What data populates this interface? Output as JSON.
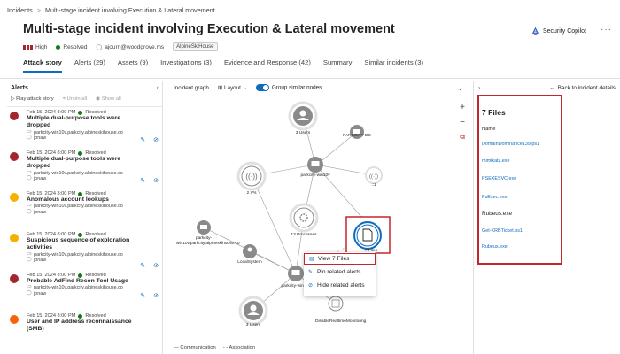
{
  "breadcrumb": [
    "Incidents",
    "Multi-stage incident involving Execution & Lateral movement"
  ],
  "title": "Multi-stage incident involving Execution & Lateral movement",
  "header_actions": {
    "copilot": "Security Copilot",
    "more": "···"
  },
  "meta": {
    "severity": "High",
    "status": "Resolved",
    "assignee": "ajourn@woodgrove.ms",
    "tag": "AlpineSkiHouse"
  },
  "tabs": [
    {
      "label": "Attack story",
      "active": true
    },
    {
      "label": "Alerts (29)"
    },
    {
      "label": "Assets (9)"
    },
    {
      "label": "Investigations (3)"
    },
    {
      "label": "Evidence and Response (42)"
    },
    {
      "label": "Summary"
    },
    {
      "label": "Similar incidents (3)"
    }
  ],
  "alerts_panel": {
    "heading": "Alerts",
    "play": "Play attack story",
    "unpin": "Unpin all",
    "show": "Show all",
    "items": [
      {
        "color": "#a4262c",
        "date": "Feb 15, 2024 8:00 PM",
        "status": "Resolved",
        "title": "Multiple dual-purpose tools were dropped",
        "device": "parkcity-win10v.parkcity.alpineskihouse.co",
        "user": "jonaw"
      },
      {
        "color": "#a4262c",
        "date": "Feb 15, 2024 8:00 PM",
        "status": "Resolved",
        "title": "Multiple dual-purpose tools were dropped",
        "device": "parkcity-win10v.parkcity.alpineskihouse.co",
        "user": "jonaw"
      },
      {
        "color": "#f8b000",
        "date": "Feb 15, 2024 8:00 PM",
        "status": "Resolved",
        "title": "Anomalous account lookups",
        "device": "parkcity-win10v.parkcity.alpineskihouse.co",
        "user": "jonaw"
      },
      {
        "color": "#f8b000",
        "date": "Feb 15, 2024 8:00 PM",
        "status": "Resolved",
        "title": "Suspicious sequence of exploration activities",
        "device": "parkcity-win10v.parkcity.alpineskihouse.co",
        "user": "jonaw"
      },
      {
        "color": "#a4262c",
        "date": "Feb 15, 2024 8:00 PM",
        "status": "Resolved",
        "title": "Probable AdFind Recon Tool Usage",
        "device": "parkcity-win10v.parkcity.alpineskihouse.co",
        "user": "jonaw"
      },
      {
        "color": "#f7630c",
        "date": "Feb 15, 2024 8:00 PM",
        "status": "Resolved",
        "title": "User and IP address reconnaissance (SMB)",
        "device": "",
        "user": ""
      }
    ]
  },
  "graph": {
    "label": "Incident graph",
    "layout": "Layout",
    "group": "Group similar nodes",
    "nodes": {
      "users_top": "3 Users",
      "dc": "PARKCITY-DC",
      "ips": "2 IPs",
      "win10v": "parkcity-win10v",
      "ip_small": "::1",
      "processes": "13 Processes",
      "files": "7 Files",
      "machine_left": "parkcity-win10v.parkcity.alpineskihouse.co",
      "local_system": "LocalSystem",
      "machine_bottom": "parkcity-win10v",
      "users_bottom": "3 Users",
      "disable_mon": "DisableRealtimeMonitoring"
    },
    "legend": {
      "communication": "Communication",
      "association": "Association"
    }
  },
  "context_menu": [
    {
      "label": "View 7 Files"
    },
    {
      "label": "Pin related alerts"
    },
    {
      "label": "Hide related alerts"
    }
  ],
  "files_pane": {
    "back": "Back to incident details",
    "title": "7 Files",
    "column": "Name",
    "files": [
      {
        "name": "DomainDominance139.ps1",
        "link": true
      },
      {
        "name": "mimikatz.exe",
        "link": true
      },
      {
        "name": "PSEXESVC.exe",
        "link": true
      },
      {
        "name": "PsExec.exe",
        "link": true
      },
      {
        "name": "Rubeus.exe",
        "link": false
      },
      {
        "name": "Get-KRBTicket.ps1",
        "link": true
      },
      {
        "name": "Rubeus.exe",
        "link": true
      }
    ]
  },
  "colors": {
    "accent": "#0f6cbd",
    "highlight": "#c4262e",
    "high": "#a4262c",
    "medium": "#f8b000",
    "low": "#f7630c",
    "resolved": "#107c10"
  }
}
